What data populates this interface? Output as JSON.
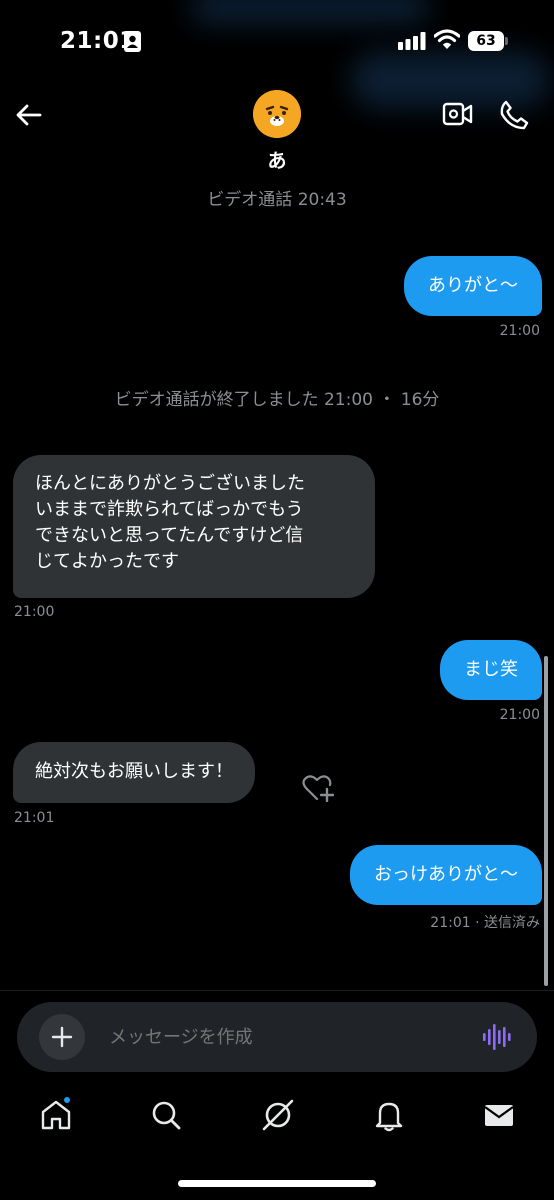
{
  "status_bar": {
    "time": "21:01",
    "battery": "63"
  },
  "header": {
    "contact_name": "あ"
  },
  "messages": {
    "sys_video_call": "ビデオ通話 20:43",
    "out_1": "ありがと〜",
    "out_1_time": "21:00",
    "sys_call_ended": "ビデオ通話が終了しました 21:00 ・ 16分",
    "in_1_lines": [
      "ほんとにありがとうございました",
      "いままで詐欺られてばっかでもう",
      "できないと思ってたんですけど信",
      "じてよかったです"
    ],
    "in_1_time": "21:00",
    "out_2": "まじ笑",
    "out_2_time": "21:00",
    "in_2": "絶対次もお願いします！",
    "in_2_time": "21:01",
    "out_3": "おっけありがと〜",
    "out_3_time": "21:01 · 送信済み"
  },
  "composer": {
    "placeholder": "メッセージを作成"
  },
  "icons": {
    "back": "back-arrow-icon",
    "video_call": "video-camera-icon",
    "phone": "phone-icon",
    "react": "heart-plus-icon",
    "add": "plus-icon",
    "voice": "voice-wave-icon",
    "tabs": [
      "home-icon",
      "search-icon",
      "grok-icon",
      "bell-icon",
      "mail-icon"
    ]
  },
  "colors": {
    "accent": "#1d9bf0",
    "incoming_bubble": "#2f3336",
    "voice_icon": "#8c6cf0"
  }
}
